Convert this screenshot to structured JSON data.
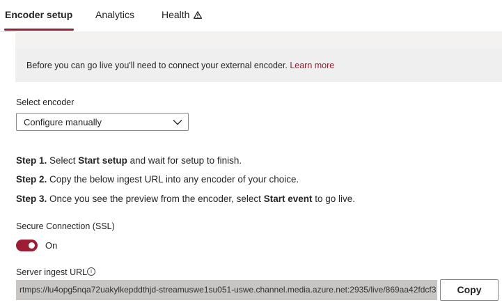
{
  "tabs": [
    {
      "label": "Encoder setup",
      "active": true
    },
    {
      "label": "Analytics",
      "active": false
    },
    {
      "label": "Health",
      "active": false,
      "icon": "warning-icon"
    }
  ],
  "banner": {
    "text": "Before you can go live you'll need to connect your external encoder. ",
    "link": "Learn more"
  },
  "encoder": {
    "label": "Select encoder",
    "value": "Configure manually"
  },
  "steps": [
    {
      "prefix": "Step 1.",
      "before": " Select ",
      "bold": "Start setup",
      "after": " and wait for setup to finish."
    },
    {
      "prefix": "Step 2.",
      "before": " Copy the below ingest URL into any encoder of your choice.",
      "bold": "",
      "after": ""
    },
    {
      "prefix": "Step 3.",
      "before": " Once you see the preview from the encoder, select ",
      "bold": "Start event",
      "after": " to go live."
    }
  ],
  "ssl": {
    "label": "Secure Connection (SSL)",
    "state": "On",
    "enabled": true
  },
  "ingest": {
    "label": "Server ingest URL",
    "url": "rtmps://lu4opg5nqa72uakylkepddthjd-streamuswe1su051-uswe.channel.media.azure.net:2935/live/869aa42fdcf3",
    "copy_label": "Copy"
  },
  "colors": {
    "accent": "#9c1d34",
    "banner_bg": "#efefef",
    "field_bg": "#c8c6c4"
  }
}
